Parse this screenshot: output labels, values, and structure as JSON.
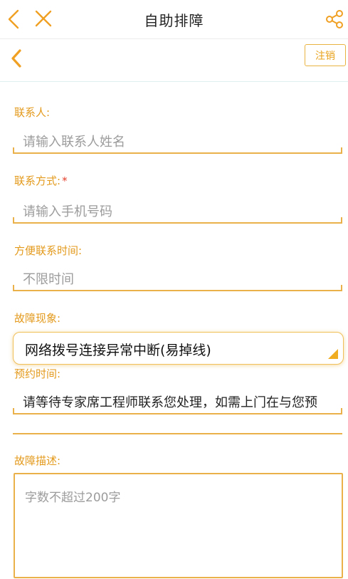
{
  "header": {
    "title": "自助排障",
    "back_icon": "chevron-left-icon",
    "close_icon": "close-icon",
    "share_icon": "share-icon"
  },
  "subbar": {
    "back_icon": "chevron-left-icon",
    "logout_label": "注销"
  },
  "form": {
    "contact_name": {
      "label": "联系人:",
      "placeholder": "请输入联系人姓名"
    },
    "contact_phone": {
      "label": "联系方式:",
      "required_mark": "*",
      "placeholder": "请输入手机号码"
    },
    "contact_time": {
      "label": "方便联系时间:",
      "value": "不限时间"
    },
    "fault": {
      "label": "故障现象:",
      "selected": "网络拨号连接异常中断(易掉线)"
    },
    "appointment": {
      "label": "预约时间:",
      "value": "请等待专家席工程师联系您处理，如需上门在与您预"
    },
    "description": {
      "label": "故障描述:",
      "placeholder": "字数不超过200字"
    }
  },
  "colors": {
    "accent": "#e39a1c",
    "line": "#eab14a",
    "required": "#e53e2b"
  }
}
